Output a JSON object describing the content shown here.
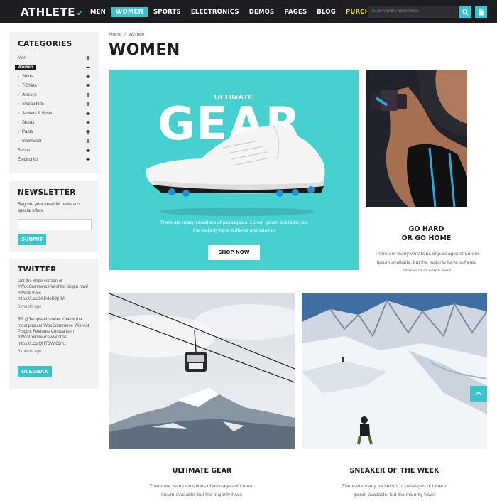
{
  "header": {
    "logo": "ATHLETE",
    "nav": [
      "MEN",
      "WOMEN",
      "SPORTS",
      "ELECTRONICS",
      "DEMOS",
      "PAGES",
      "BLOG",
      "PURCHASE"
    ],
    "active_nav": "WOMEN",
    "search_placeholder": "Search entire store here..."
  },
  "sidebar": {
    "categories_title": "CATEGORIES",
    "categories": [
      {
        "label": "Men",
        "type": "top"
      },
      {
        "label": "Women",
        "type": "active"
      },
      {
        "label": "Shirts",
        "type": "sub"
      },
      {
        "label": "T-Shirts",
        "type": "sub"
      },
      {
        "label": "Jerseys",
        "type": "sub"
      },
      {
        "label": "Sweatshirts",
        "type": "sub"
      },
      {
        "label": "Jackets & Vests",
        "type": "sub"
      },
      {
        "label": "Shorts",
        "type": "sub"
      },
      {
        "label": "Pants",
        "type": "sub"
      },
      {
        "label": "Swimwear",
        "type": "sub"
      },
      {
        "label": "Sports",
        "type": "top"
      },
      {
        "label": "Electronics",
        "type": "top"
      }
    ],
    "newsletter_title": "NEWSLETTER",
    "newsletter_text": "Register your email for news and special offers",
    "submit_label": "SUBMIT",
    "twitter_title": "TWITTER",
    "tweets": [
      {
        "lines": [
          "Get the #free version of",
          "#WooCommerce Wishlist plugin now!",
          "#WordPress",
          "https://t.co/8AR4oB9jHM"
        ],
        "ago": "6 month ago"
      },
      {
        "lines": [
          "RT @TemplateInvader: Check the",
          "most popular WooCommerce Wishlist",
          "Plugins Features Comparison",
          "#WooCommerce #Wishlist",
          "https://t.co/QHT6Yvj82m..."
        ],
        "ago": "6 month ago"
      }
    ],
    "follow_label": "OLEGNAX"
  },
  "main": {
    "breadcrumb_home": "Home",
    "breadcrumb_sep": "/",
    "breadcrumb_current": "Women",
    "page_title": "WOMEN",
    "hero": {
      "kicker": "ULTIMATE",
      "headline": "GEAR",
      "description": "There are many variations of passages of Lorem Ipsum available, but the majority have suffered alteration in",
      "cta": "SHOP NOW"
    },
    "promo": {
      "title_line1": "GO HARD",
      "title_line2": "OR GO HOME",
      "description": "There are many variations of passages of Lorem Ipsum available, but the majority have suffered alteration in some form"
    },
    "cards": [
      {
        "title": "ULTIMATE GEAR",
        "description": "There are many variations of passages of Lorem Ipsum available, but the majority have"
      },
      {
        "title": "SNEAKER OF THE WEEK",
        "description": "There are many variations of passages of Lorem Ipsum available, but the majority have"
      }
    ]
  },
  "colors": {
    "accent": "#37c6d0",
    "dark": "#1c1c21",
    "hero_bg": "#46d0cf",
    "purchase": "#e4e34b"
  }
}
